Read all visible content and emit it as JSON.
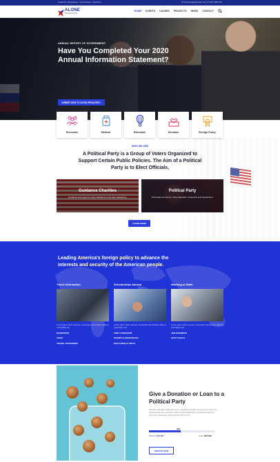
{
  "topbar": {
    "left": "Students • Employers • Job Seekers • Students",
    "right": "✉ hisname@sitename.com   ✆ (00) 0000 111"
  },
  "header": {
    "brand": "ALONE",
    "tagline": "Political Party",
    "nav": [
      "HOME",
      "EVENTS",
      "CAUSES",
      "PROJECTS",
      "NEWS",
      "CONTACT"
    ]
  },
  "hero": {
    "kicker": "ANNUAL REPORT OF GOVERNMENT",
    "title": "Have You Completed Your 2020 Annual Information Statement?",
    "cta": "SUBMIT NOW TO AVOID PENALTIES  ›"
  },
  "features": [
    {
      "label": "Economic",
      "icon": "people-group-icon"
    },
    {
      "label": "Medical",
      "icon": "medicine-bottle-icon"
    },
    {
      "label": "Education",
      "icon": "hot-air-balloon-icon"
    },
    {
      "label": "Donation",
      "icon": "heart-box-icon"
    },
    {
      "label": "Foreign Policy",
      "icon": "certificate-ribbon-icon"
    }
  ],
  "who": {
    "eyebrow": "WHO WE ARE",
    "statement": "A Political Party is a Group of Voters Organized to Support Certain Public Policies. The Aim of a Political Party is to Elect Officials,",
    "tiles": [
      {
        "title": "Guidance Charities",
        "desc": "Guidance and support to help charities to meet their obligations."
      },
      {
        "title": "Political Party",
        "desc": "Information for donors, Party Members, treasurers and researchers."
      }
    ],
    "more": "LEARN MORE"
  },
  "blue": {
    "headline": "Leading America's foreign policy to advance the interests and security of the American people.",
    "columns": [
      {
        "heading": "Travel Information",
        "desc": "Lorem ipsum dolor sit amet, consectetur adi tincidunt ullamco exercitation elit.",
        "links": [
          "PASSPORTS",
          "VISAS",
          "TRAVEL ADVISORIES"
        ]
      },
      {
        "heading": "Scholarships Abroad",
        "desc": "Lorem ipsum dolor sit amet, consectetur adi tincidunt ullamco exercitation elit.",
        "links": [
          "FIND A PROGRAM",
          "GRANTS & RESOURCES",
          "EDUCATION & VISITS"
        ]
      },
      {
        "heading": "Working at State",
        "desc": "Lorem ipsum dolor sit amet, consectetur adi tincidunt ullamco exercitation elit.",
        "links": [
          "JOB OPENINGS",
          "GOVT POLICY"
        ]
      }
    ]
  },
  "donation": {
    "title": "Give a Donation or Loan to a Political Party",
    "desc": "Aliquam phasellus turpis leo mi eu, id defined porttitor elit sed ut mi. Ad ex mi pellentesque quis, leo ipsum dolor sit. Ea sollicitudin vel lobortis id sed nisi lorem per accumsan magna dictum proin ut at.",
    "progress_percent": 48,
    "progress_label": "48%",
    "raised_label": "Raised:",
    "raised_value": "$10,897",
    "goal_label": "Goal:",
    "goal_value": "$23,639",
    "button": "DONATE NOW"
  },
  "colors": {
    "accent": "#2a3fdd",
    "navy": "#1a2a8c",
    "blue_section": "#2033d6"
  }
}
